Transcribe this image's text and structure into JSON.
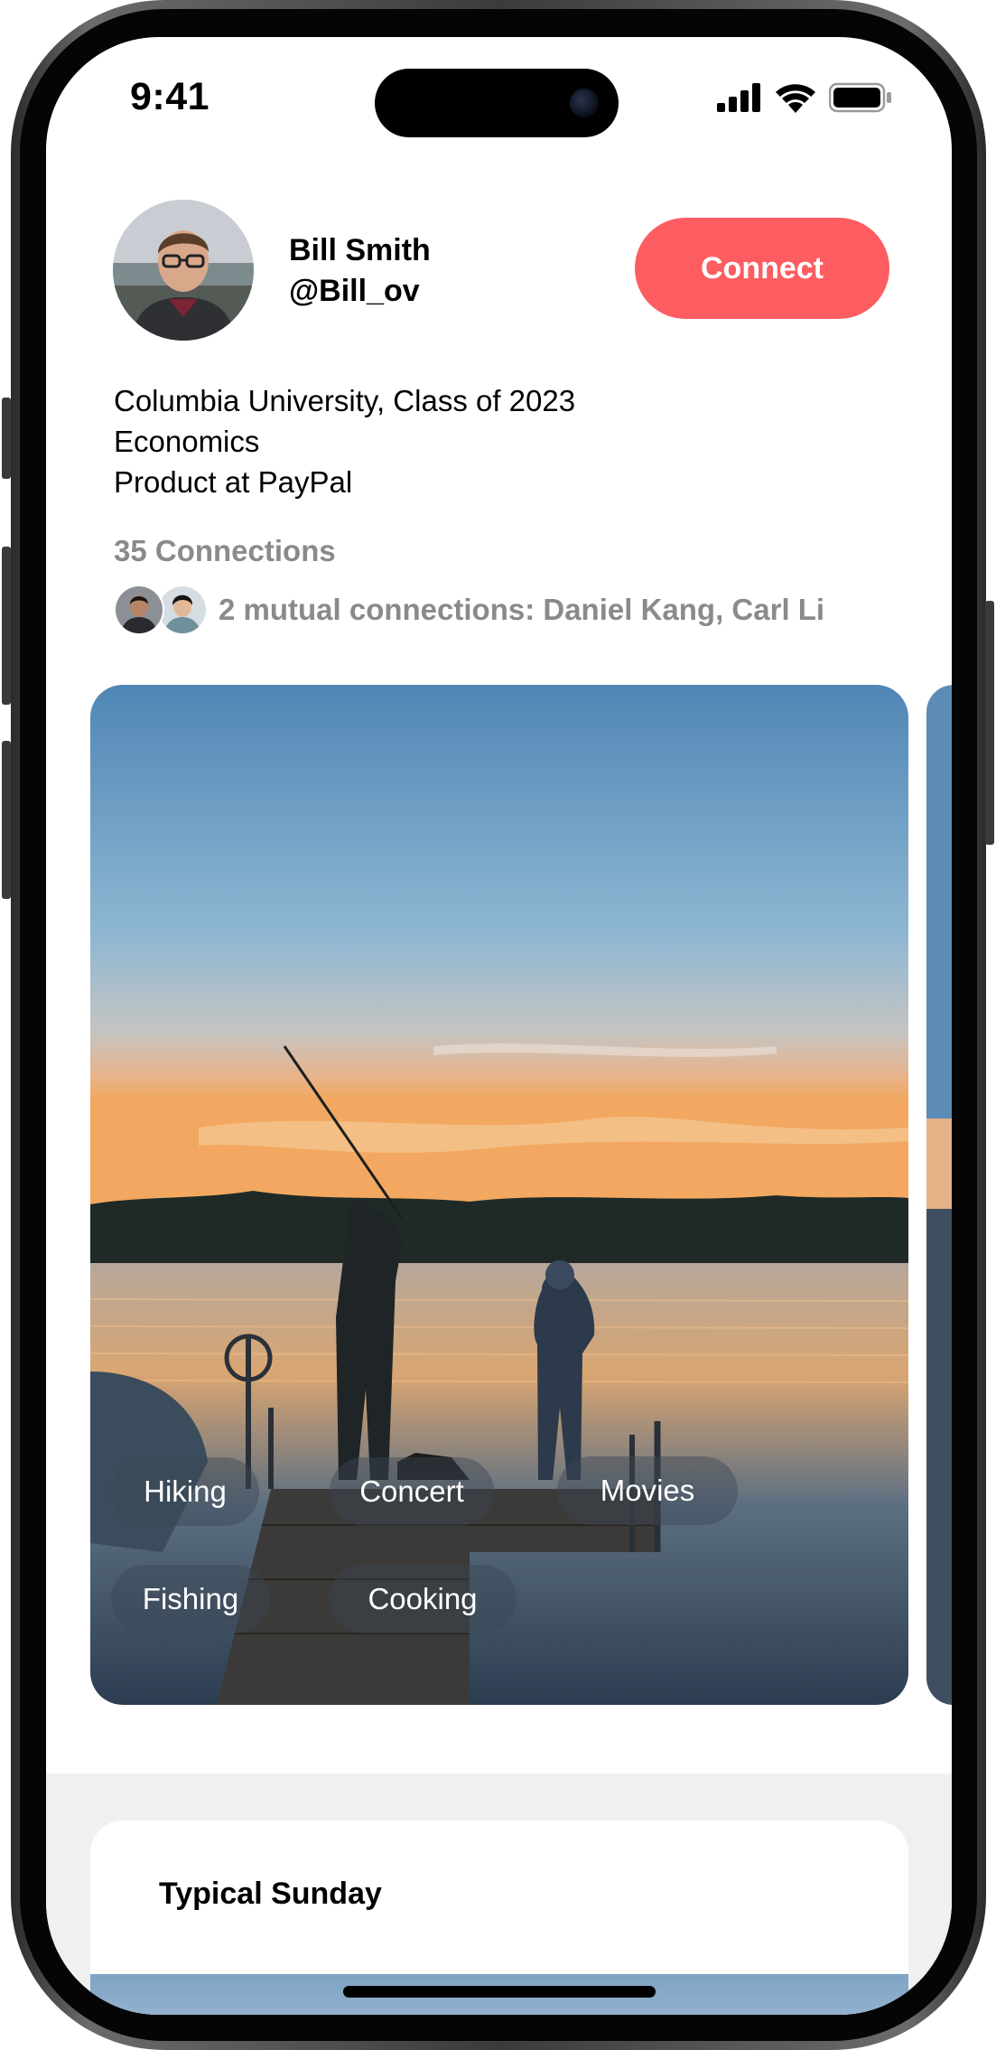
{
  "status_bar": {
    "time": "9:41"
  },
  "profile": {
    "name": "Bill Smith",
    "handle": "@Bill_ov",
    "connect_label": "Connect",
    "bio": [
      "Columbia University, Class of 2023",
      "Economics",
      "Product at PayPal"
    ],
    "connections_count_text": "35 Connections",
    "mutual_connections_text": "2 mutual connections: Daniel Kang, Carl Li"
  },
  "interests": [
    "Hiking",
    "Concert",
    "Movies",
    "Fishing",
    "Cooking"
  ],
  "section_card": {
    "title": "Typical Sunday"
  },
  "colors": {
    "accent": "#fd5d61",
    "muted_text": "#8a8a8a",
    "section_bg": "#f0f0f0"
  }
}
